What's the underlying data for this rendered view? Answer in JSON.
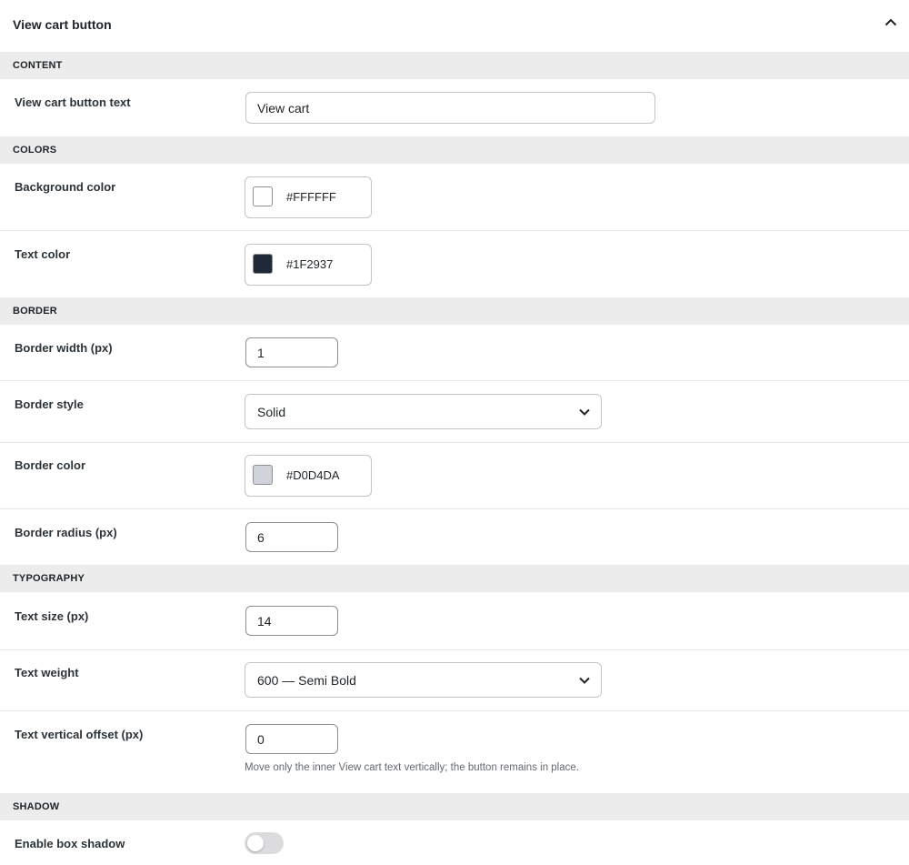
{
  "panel": {
    "title": "View cart button",
    "collapse_icon": "chevron-up-icon"
  },
  "content": {
    "heading": "CONTENT",
    "view_cart_text": {
      "label": "View cart button text",
      "value": "View cart"
    }
  },
  "colors": {
    "heading": "COLORS",
    "background": {
      "label": "Background color",
      "hex": "#FFFFFF",
      "swatch": "#FFFFFF"
    },
    "text": {
      "label": "Text color",
      "hex": "#1F2937",
      "swatch": "#1F2937"
    }
  },
  "border": {
    "heading": "BORDER",
    "width": {
      "label": "Border width (px)",
      "value": "1"
    },
    "style": {
      "label": "Border style",
      "value": "Solid",
      "icon": "chevron-down-icon"
    },
    "color": {
      "label": "Border color",
      "hex": "#D0D4DA",
      "swatch": "#D0D4DA"
    },
    "radius": {
      "label": "Border radius (px)",
      "value": "6"
    }
  },
  "typography": {
    "heading": "TYPOGRAPHY",
    "size": {
      "label": "Text size (px)",
      "value": "14"
    },
    "weight": {
      "label": "Text weight",
      "value": "600 — Semi Bold",
      "icon": "chevron-down-icon"
    },
    "offset": {
      "label": "Text vertical offset (px)",
      "value": "0",
      "help": "Move only the inner View cart text vertically; the button remains in place."
    }
  },
  "shadow": {
    "heading": "SHADOW",
    "enable": {
      "label": "Enable box shadow",
      "checked": false
    }
  }
}
